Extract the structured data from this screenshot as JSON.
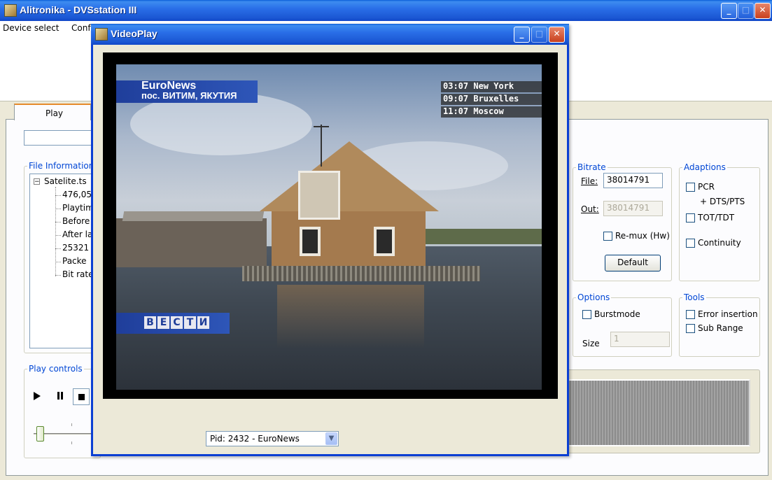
{
  "main_window": {
    "title": "Alitronika - DVSstation III",
    "menu": [
      "Device select",
      "Conf"
    ],
    "tab_play": "Play",
    "file_info_label": "File Information",
    "tree": {
      "root": "Satelite.ts",
      "children": [
        "476,05",
        "Playtim",
        "Before",
        "After la",
        "25321",
        "Packe",
        "Bit rate"
      ]
    },
    "play_controls_label": "Play controls",
    "bitrate": {
      "label": "Bitrate",
      "file_label": "File:",
      "file_value": "38014791",
      "out_label": "Out:",
      "out_value": "38014791",
      "remux_label": "Re-mux (Hw)",
      "default_button": "Default"
    },
    "adaptions": {
      "label": "Adaptions",
      "pcr": "PCR",
      "dts_pts": "+ DTS/PTS",
      "tot_tdt": "TOT/TDT",
      "continuity": "Continuity"
    },
    "options": {
      "label": "Options",
      "burstmode": "Burstmode",
      "size_label": "Size",
      "size_value": "1"
    },
    "tools": {
      "label": "Tools",
      "error_insertion": "Error insertion",
      "sub_range": "Sub Range"
    }
  },
  "video_window": {
    "title": "VideoPlay",
    "pid_select": "Pid: 2432 - EuroNews",
    "overlay": {
      "channel": "EuroNews",
      "location": "пос. ВИТИМ, ЯКУТИЯ",
      "times": [
        "03:07 New York",
        "09:07 Bruxelles",
        "11:07 Moscow"
      ],
      "logo_letters": [
        "В",
        "Е",
        "С",
        "Т",
        "И"
      ]
    }
  }
}
